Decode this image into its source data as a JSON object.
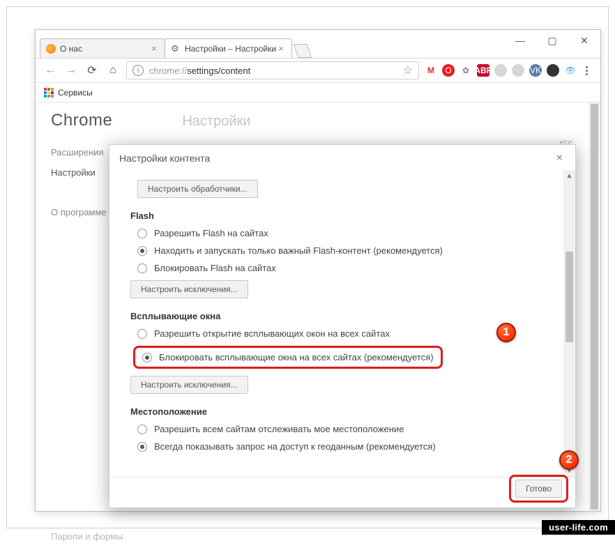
{
  "window": {
    "min": "—",
    "max": "▢",
    "close": "✕"
  },
  "tabs": {
    "t1": {
      "title": "О нас"
    },
    "t2": {
      "title": "Настройки – Настройки"
    }
  },
  "toolbar": {
    "url_prefix": "chrome://",
    "url_path": "settings/content"
  },
  "bookmarks": {
    "apps": "Сервисы"
  },
  "page": {
    "title": "Chrome",
    "section_header": "Настройки",
    "nav1": "Расширения",
    "nav2": "Настройки",
    "about": "О программе",
    "hint": "ете",
    "forms": "Пароли и формы"
  },
  "dialog": {
    "title": "Настройки контента",
    "handlers_btn": "Настроить обработчики...",
    "flash": {
      "title": "Flash",
      "r1": "Разрешить Flash на сайтах",
      "r2": "Находить и запускать только важный Flash-контент (рекомендуется)",
      "r3": "Блокировать Flash на сайтах",
      "exceptions": "Настроить исключения..."
    },
    "popups": {
      "title": "Всплывающие окна",
      "r1": "Разрешить открытие всплывающих окон на всех сайтах",
      "r2": "Блокировать всплывающие окна на всех сайтах (рекомендуется)",
      "exceptions": "Настроить исключения..."
    },
    "location": {
      "title": "Местоположение",
      "r1": "Разрешить всем сайтам отслеживать мое местоположение",
      "r2": "Всегда показывать запрос на доступ к геоданным (рекомендуется)"
    },
    "done": "Готово"
  },
  "badges": {
    "b1": "1",
    "b2": "2"
  },
  "watermark": "user-life.com"
}
